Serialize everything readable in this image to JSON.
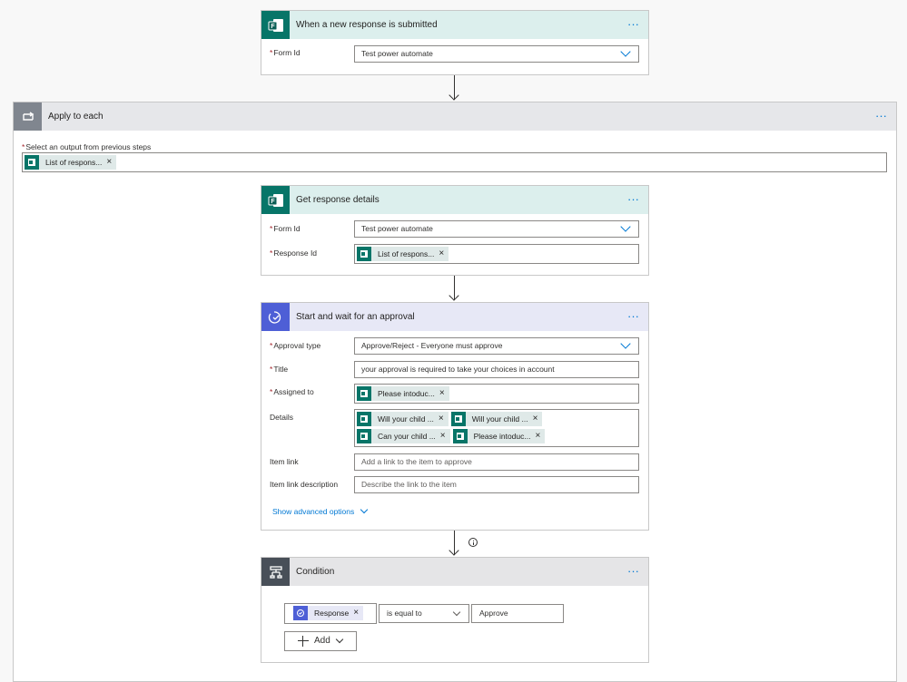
{
  "trigger": {
    "title": "When a new response is submitted",
    "form_id_label": "Form Id",
    "form_id_value": "Test power automate"
  },
  "apply": {
    "title": "Apply to each",
    "select_label": "Select an output from previous steps",
    "select_token": "List of respons..."
  },
  "get_details": {
    "title": "Get response details",
    "form_id_label": "Form Id",
    "form_id_value": "Test power automate",
    "response_id_label": "Response Id",
    "response_id_token": "List of respons..."
  },
  "approval": {
    "title": "Start and wait for an approval",
    "type_label": "Approval type",
    "type_value": "Approve/Reject - Everyone must approve",
    "title_label": "Title",
    "title_value": "your approval is required to take your choices in account",
    "assigned_label": "Assigned to",
    "assigned_token": "Please intoduc...",
    "details_label": "Details",
    "details_tokens": [
      "Will your child ...",
      "Will your child ...",
      "Can your child ...",
      "Please intoduc..."
    ],
    "item_link_label": "Item link",
    "item_link_placeholder": "Add a link to the item to approve",
    "item_link_desc_label": "Item link description",
    "item_link_desc_placeholder": "Describe the link to the item",
    "advanced": "Show advanced options"
  },
  "condition": {
    "title": "Condition",
    "left_token": "Response",
    "operator": "is equal to",
    "right_value": "Approve",
    "add_label": "Add"
  },
  "common": {
    "more": "···",
    "remove": "×",
    "required": "*"
  },
  "colors": {
    "forms": "#077568",
    "approval": "#4e5fd6",
    "condition": "#484f58",
    "link": "#0078d4"
  }
}
